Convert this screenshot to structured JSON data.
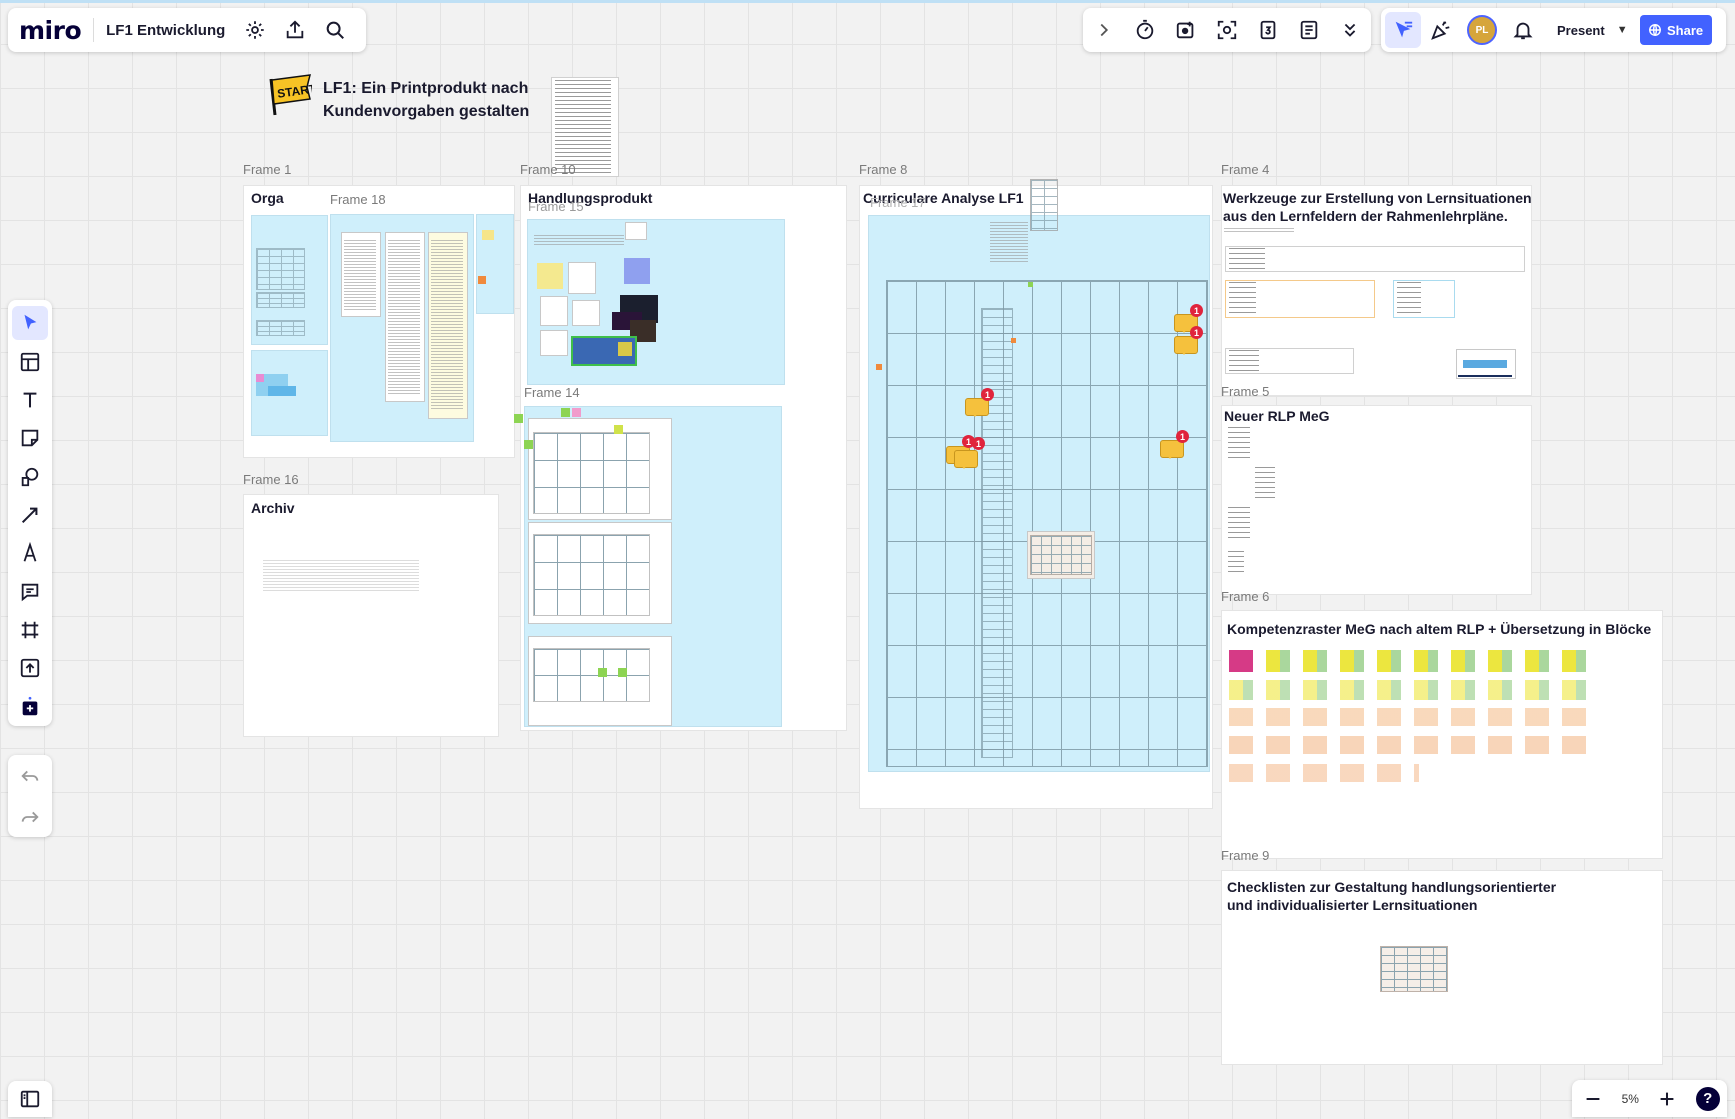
{
  "app": {
    "logo": "miro",
    "board_name": "LF1 Entwicklung"
  },
  "toolbar": {
    "present_label": "Present",
    "share_label": "Share",
    "avatar_initials": "PL",
    "zoom_level": "5%",
    "help_label": "?"
  },
  "board": {
    "start_sticker": "START",
    "title_line1": "LF1: Ein Printprodukt nach",
    "title_line2": "Kundenvorgaben gestalten"
  },
  "frames": {
    "f1_label": "Frame 1",
    "f1_title": "Orga",
    "f18_label": "Frame 18",
    "f10_label": "Frame 10",
    "f10_title": "Handlungsprodukt",
    "f15_label": "Frame 15",
    "f14_label": "Frame 14",
    "f8_label": "Frame 8",
    "f8_title": "Curriculare Analyse LF1",
    "f17_label": "Frame 17",
    "f16_label": "Frame 16",
    "f16_title": "Archiv",
    "f4_label": "Frame 4",
    "f4_title_line1": "Werkzeuge zur Erstellung von Lernsituationen",
    "f4_title_line2": "aus den Lernfeldern der Rahmenlehrpläne.",
    "f5_label": "Frame 5",
    "f5_title": "Neuer RLP MeG",
    "f6_label": "Frame 6",
    "f6_title": "Kompetenzraster MeG nach altem RLP + Übersetzung in Blöcke",
    "f9_label": "Frame 9",
    "f9_title_line1": "Checklisten zur Gestaltung handlungsorientierter",
    "f9_title_line2": "und individualisierter Lernsituationen"
  },
  "comment_badges": [
    "1",
    "1",
    "1",
    "1",
    "1",
    "1"
  ],
  "icons": {
    "top_left": [
      "settings-icon",
      "upload-icon",
      "search-icon"
    ],
    "top_right": [
      "chevron-right-icon",
      "timer-icon",
      "voting-icon",
      "focus-icon",
      "calendar-icon",
      "notes-icon",
      "chevrons-down-icon"
    ],
    "collab": [
      "cursor-filter-icon",
      "reactions-icon",
      "bell-icon"
    ],
    "left_tools": [
      "select-icon",
      "templates-icon",
      "text-icon",
      "sticky-note-icon",
      "shapes-icon",
      "connector-icon",
      "pen-icon",
      "comment-icon",
      "frame-icon",
      "upload-tool-icon",
      "add-apps-icon"
    ],
    "history": [
      "undo-icon",
      "redo-icon"
    ]
  }
}
